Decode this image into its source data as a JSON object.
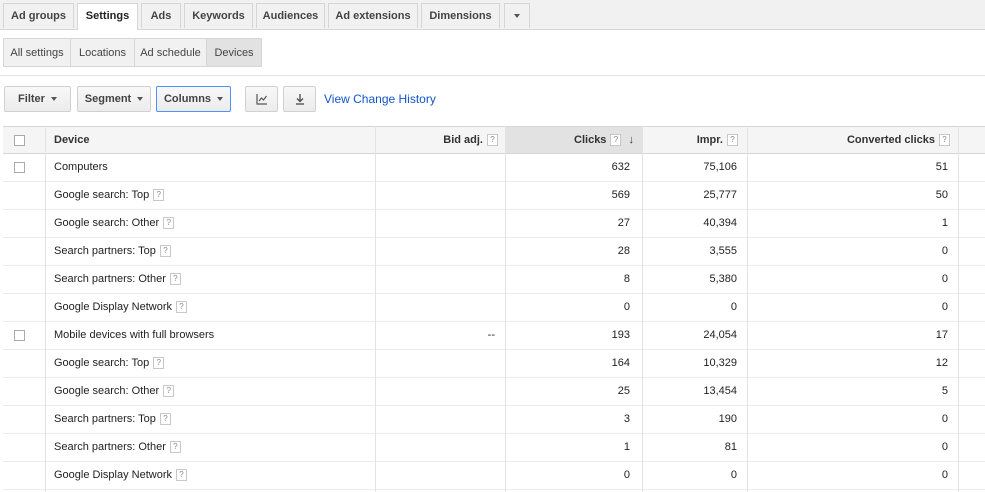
{
  "tabs": [
    "Ad groups",
    "Settings",
    "Ads",
    "Keywords",
    "Audiences",
    "Ad extensions",
    "Dimensions"
  ],
  "active_tab": "Settings",
  "subtabs": [
    "All settings",
    "Locations",
    "Ad schedule",
    "Devices"
  ],
  "active_subtab": "Devices",
  "toolbar": {
    "filter_label": "Filter",
    "segment_label": "Segment",
    "columns_label": "Columns",
    "chart_icon": "line-chart-icon",
    "download_icon": "download-icon",
    "history_link": "View Change History"
  },
  "table": {
    "headers": {
      "device": "Device",
      "bid_adj": "Bid adj.",
      "clicks": "Clicks",
      "impr": "Impr.",
      "converted": "Converted clicks",
      "help": "?",
      "sort_arrow": "↓"
    },
    "rows": [
      {
        "device": "Computers",
        "bid_adj": "",
        "clicks": "632",
        "impr": "75,106",
        "converted": "51",
        "top": true,
        "help": false
      },
      {
        "device": "Google search: Top",
        "bid_adj": "",
        "clicks": "569",
        "impr": "25,777",
        "converted": "50",
        "top": false,
        "help": true
      },
      {
        "device": "Google search: Other",
        "bid_adj": "",
        "clicks": "27",
        "impr": "40,394",
        "converted": "1",
        "top": false,
        "help": true
      },
      {
        "device": "Search partners: Top",
        "bid_adj": "",
        "clicks": "28",
        "impr": "3,555",
        "converted": "0",
        "top": false,
        "help": true
      },
      {
        "device": "Search partners: Other",
        "bid_adj": "",
        "clicks": "8",
        "impr": "5,380",
        "converted": "0",
        "top": false,
        "help": true
      },
      {
        "device": "Google Display Network",
        "bid_adj": "",
        "clicks": "0",
        "impr": "0",
        "converted": "0",
        "top": false,
        "help": true
      },
      {
        "device": "Mobile devices with full browsers",
        "bid_adj": "--",
        "clicks": "193",
        "impr": "24,054",
        "converted": "17",
        "top": true,
        "help": false
      },
      {
        "device": "Google search: Top",
        "bid_adj": "",
        "clicks": "164",
        "impr": "10,329",
        "converted": "12",
        "top": false,
        "help": true
      },
      {
        "device": "Google search: Other",
        "bid_adj": "",
        "clicks": "25",
        "impr": "13,454",
        "converted": "5",
        "top": false,
        "help": true
      },
      {
        "device": "Search partners: Top",
        "bid_adj": "",
        "clicks": "3",
        "impr": "190",
        "converted": "0",
        "top": false,
        "help": true
      },
      {
        "device": "Search partners: Other",
        "bid_adj": "",
        "clicks": "1",
        "impr": "81",
        "converted": "0",
        "top": false,
        "help": true
      },
      {
        "device": "Google Display Network",
        "bid_adj": "",
        "clicks": "0",
        "impr": "0",
        "converted": "0",
        "top": false,
        "help": true
      }
    ]
  }
}
